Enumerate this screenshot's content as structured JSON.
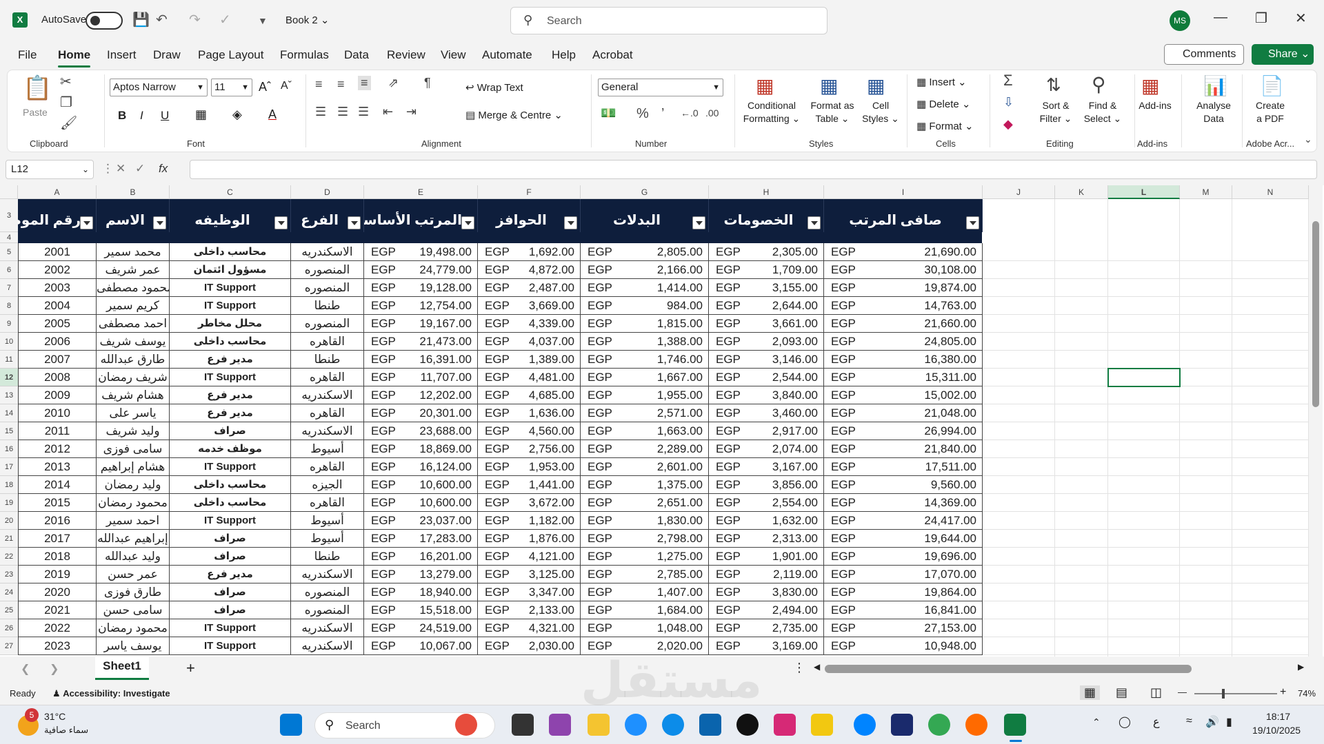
{
  "titlebar": {
    "app_icon": "X",
    "autosave_label": "AutoSave",
    "book_title": "Book 2",
    "search_placeholder": "Search",
    "avatar": "MS"
  },
  "menu": {
    "items": [
      "File",
      "Home",
      "Insert",
      "Draw",
      "Page Layout",
      "Formulas",
      "Data",
      "Review",
      "View",
      "Automate",
      "Help",
      "Acrobat"
    ],
    "comments": "Comments",
    "share": "Share"
  },
  "ribbon": {
    "clipboard": {
      "paste": "Paste",
      "label": "Clipboard"
    },
    "font": {
      "name": "Aptos Narrow",
      "size": "11",
      "label": "Font"
    },
    "alignment": {
      "wrap": "Wrap Text",
      "merge": "Merge & Centre",
      "label": "Alignment"
    },
    "number": {
      "format": "General",
      "label": "Number"
    },
    "styles": {
      "conditional": "Conditional",
      "conditional2": "Formatting",
      "format_table": "Format as",
      "format_table2": "Table",
      "cell_styles": "Cell",
      "cell_styles2": "Styles",
      "label": "Styles"
    },
    "cells": {
      "insert": "Insert",
      "delete": "Delete",
      "format": "Format",
      "label": "Cells"
    },
    "editing": {
      "sort": "Sort &",
      "sort2": "Filter",
      "find": "Find &",
      "find2": "Select",
      "label": "Editing"
    },
    "addins": {
      "addins": "Add-ins",
      "label": "Add-ins"
    },
    "analyse": {
      "l1": "Analyse",
      "l2": "Data"
    },
    "acrobat": {
      "l1": "Create",
      "l2": "a PDF",
      "label": "Adobe Acr..."
    }
  },
  "formula": {
    "namebox": "L12",
    "fx": "fx"
  },
  "columns": [
    "A",
    "B",
    "C",
    "D",
    "E",
    "F",
    "G",
    "H",
    "I",
    "J",
    "K",
    "L",
    "M",
    "N"
  ],
  "headers": [
    "رقم الموظف",
    "الاسم",
    "الوظيفه",
    "الفرع",
    "المرتب الأساسي",
    "الحوافز",
    "البدلات",
    "الخصومات",
    "صافى المرتب"
  ],
  "currency": "EGP",
  "rows": [
    {
      "r": "5",
      "id": "2001",
      "name": "محمد سمير",
      "job": "محاسب داخلى",
      "branch": "الاسكندريه",
      "base": "19,498.00",
      "bonus": "1,692.00",
      "allow": "2,805.00",
      "ded": "2,305.00",
      "net": "21,690.00"
    },
    {
      "r": "6",
      "id": "2002",
      "name": "عمر شريف",
      "job": "مسؤول ائتمان",
      "branch": "المنصوره",
      "base": "24,779.00",
      "bonus": "4,872.00",
      "allow": "2,166.00",
      "ded": "1,709.00",
      "net": "30,108.00"
    },
    {
      "r": "7",
      "id": "2003",
      "name": "محمود مصطفى",
      "job": "IT Support",
      "branch": "المنصوره",
      "base": "19,128.00",
      "bonus": "2,487.00",
      "allow": "1,414.00",
      "ded": "3,155.00",
      "net": "19,874.00"
    },
    {
      "r": "8",
      "id": "2004",
      "name": "كريم سمير",
      "job": "IT Support",
      "branch": "طنطا",
      "base": "12,754.00",
      "bonus": "3,669.00",
      "allow": "984.00",
      "ded": "2,644.00",
      "net": "14,763.00"
    },
    {
      "r": "9",
      "id": "2005",
      "name": "احمد مصطفى",
      "job": "محلل مخاطر",
      "branch": "المنصوره",
      "base": "19,167.00",
      "bonus": "4,339.00",
      "allow": "1,815.00",
      "ded": "3,661.00",
      "net": "21,660.00"
    },
    {
      "r": "10",
      "id": "2006",
      "name": "يوسف شريف",
      "job": "محاسب داخلى",
      "branch": "القاهره",
      "base": "21,473.00",
      "bonus": "4,037.00",
      "allow": "1,388.00",
      "ded": "2,093.00",
      "net": "24,805.00"
    },
    {
      "r": "11",
      "id": "2007",
      "name": "طارق عبدالله",
      "job": "مدير فرع",
      "branch": "طنطا",
      "base": "16,391.00",
      "bonus": "1,389.00",
      "allow": "1,746.00",
      "ded": "3,146.00",
      "net": "16,380.00"
    },
    {
      "r": "12",
      "id": "2008",
      "name": "شريف رمضان",
      "job": "IT Support",
      "branch": "القاهره",
      "base": "11,707.00",
      "bonus": "4,481.00",
      "allow": "1,667.00",
      "ded": "2,544.00",
      "net": "15,311.00"
    },
    {
      "r": "13",
      "id": "2009",
      "name": "هشام شريف",
      "job": "مدير فرع",
      "branch": "الاسكندريه",
      "base": "12,202.00",
      "bonus": "4,685.00",
      "allow": "1,955.00",
      "ded": "3,840.00",
      "net": "15,002.00"
    },
    {
      "r": "14",
      "id": "2010",
      "name": "ياسر على",
      "job": "مدير فرع",
      "branch": "القاهره",
      "base": "20,301.00",
      "bonus": "1,636.00",
      "allow": "2,571.00",
      "ded": "3,460.00",
      "net": "21,048.00"
    },
    {
      "r": "15",
      "id": "2011",
      "name": "وليد شريف",
      "job": "صراف",
      "branch": "الاسكندريه",
      "base": "23,688.00",
      "bonus": "4,560.00",
      "allow": "1,663.00",
      "ded": "2,917.00",
      "net": "26,994.00"
    },
    {
      "r": "16",
      "id": "2012",
      "name": "سامى فوزى",
      "job": "موظف خدمه",
      "branch": "أسيوط",
      "base": "18,869.00",
      "bonus": "2,756.00",
      "allow": "2,289.00",
      "ded": "2,074.00",
      "net": "21,840.00"
    },
    {
      "r": "17",
      "id": "2013",
      "name": "هشام إبراهيم",
      "job": "IT Support",
      "branch": "القاهره",
      "base": "16,124.00",
      "bonus": "1,953.00",
      "allow": "2,601.00",
      "ded": "3,167.00",
      "net": "17,511.00"
    },
    {
      "r": "18",
      "id": "2014",
      "name": "وليد رمضان",
      "job": "محاسب داخلى",
      "branch": "الجيزه",
      "base": "10,600.00",
      "bonus": "1,441.00",
      "allow": "1,375.00",
      "ded": "3,856.00",
      "net": "9,560.00"
    },
    {
      "r": "19",
      "id": "2015",
      "name": "محمود رمضان",
      "job": "محاسب داخلى",
      "branch": "القاهره",
      "base": "10,600.00",
      "bonus": "3,672.00",
      "allow": "2,651.00",
      "ded": "2,554.00",
      "net": "14,369.00"
    },
    {
      "r": "20",
      "id": "2016",
      "name": "احمد سمير",
      "job": "IT Support",
      "branch": "أسيوط",
      "base": "23,037.00",
      "bonus": "1,182.00",
      "allow": "1,830.00",
      "ded": "1,632.00",
      "net": "24,417.00"
    },
    {
      "r": "21",
      "id": "2017",
      "name": "إبراهيم عبدالله",
      "job": "صراف",
      "branch": "أسيوط",
      "base": "17,283.00",
      "bonus": "1,876.00",
      "allow": "2,798.00",
      "ded": "2,313.00",
      "net": "19,644.00"
    },
    {
      "r": "22",
      "id": "2018",
      "name": "وليد عبدالله",
      "job": "صراف",
      "branch": "طنطا",
      "base": "16,201.00",
      "bonus": "4,121.00",
      "allow": "1,275.00",
      "ded": "1,901.00",
      "net": "19,696.00"
    },
    {
      "r": "23",
      "id": "2019",
      "name": "عمر حسن",
      "job": "مدير فرع",
      "branch": "الاسكندريه",
      "base": "13,279.00",
      "bonus": "3,125.00",
      "allow": "2,785.00",
      "ded": "2,119.00",
      "net": "17,070.00"
    },
    {
      "r": "24",
      "id": "2020",
      "name": "طارق فوزى",
      "job": "صراف",
      "branch": "المنصوره",
      "base": "18,940.00",
      "bonus": "3,347.00",
      "allow": "1,407.00",
      "ded": "3,830.00",
      "net": "19,864.00"
    },
    {
      "r": "25",
      "id": "2021",
      "name": "سامى حسن",
      "job": "صراف",
      "branch": "المنصوره",
      "base": "15,518.00",
      "bonus": "2,133.00",
      "allow": "1,684.00",
      "ded": "2,494.00",
      "net": "16,841.00"
    },
    {
      "r": "26",
      "id": "2022",
      "name": "محمود رمضان",
      "job": "IT Support",
      "branch": "الاسكندريه",
      "base": "24,519.00",
      "bonus": "4,321.00",
      "allow": "1,048.00",
      "ded": "2,735.00",
      "net": "27,153.00"
    },
    {
      "r": "27",
      "id": "2023",
      "name": "يوسف ياسر",
      "job": "IT Support",
      "branch": "الاسكندريه",
      "base": "10,067.00",
      "bonus": "2,030.00",
      "allow": "2,020.00",
      "ded": "3,169.00",
      "net": "10,948.00"
    }
  ],
  "sheet": {
    "name": "Sheet1",
    "add": "+"
  },
  "status": {
    "ready": "Ready",
    "accessibility": "Accessibility: Investigate",
    "zoom": "74%"
  },
  "taskbar": {
    "temp": "31°C",
    "weather": "سماء صافية",
    "badge": "5",
    "search": "Search",
    "time": "18:17",
    "date": "19/10/2025",
    "lang": "ع"
  },
  "watermark": "مستقل"
}
